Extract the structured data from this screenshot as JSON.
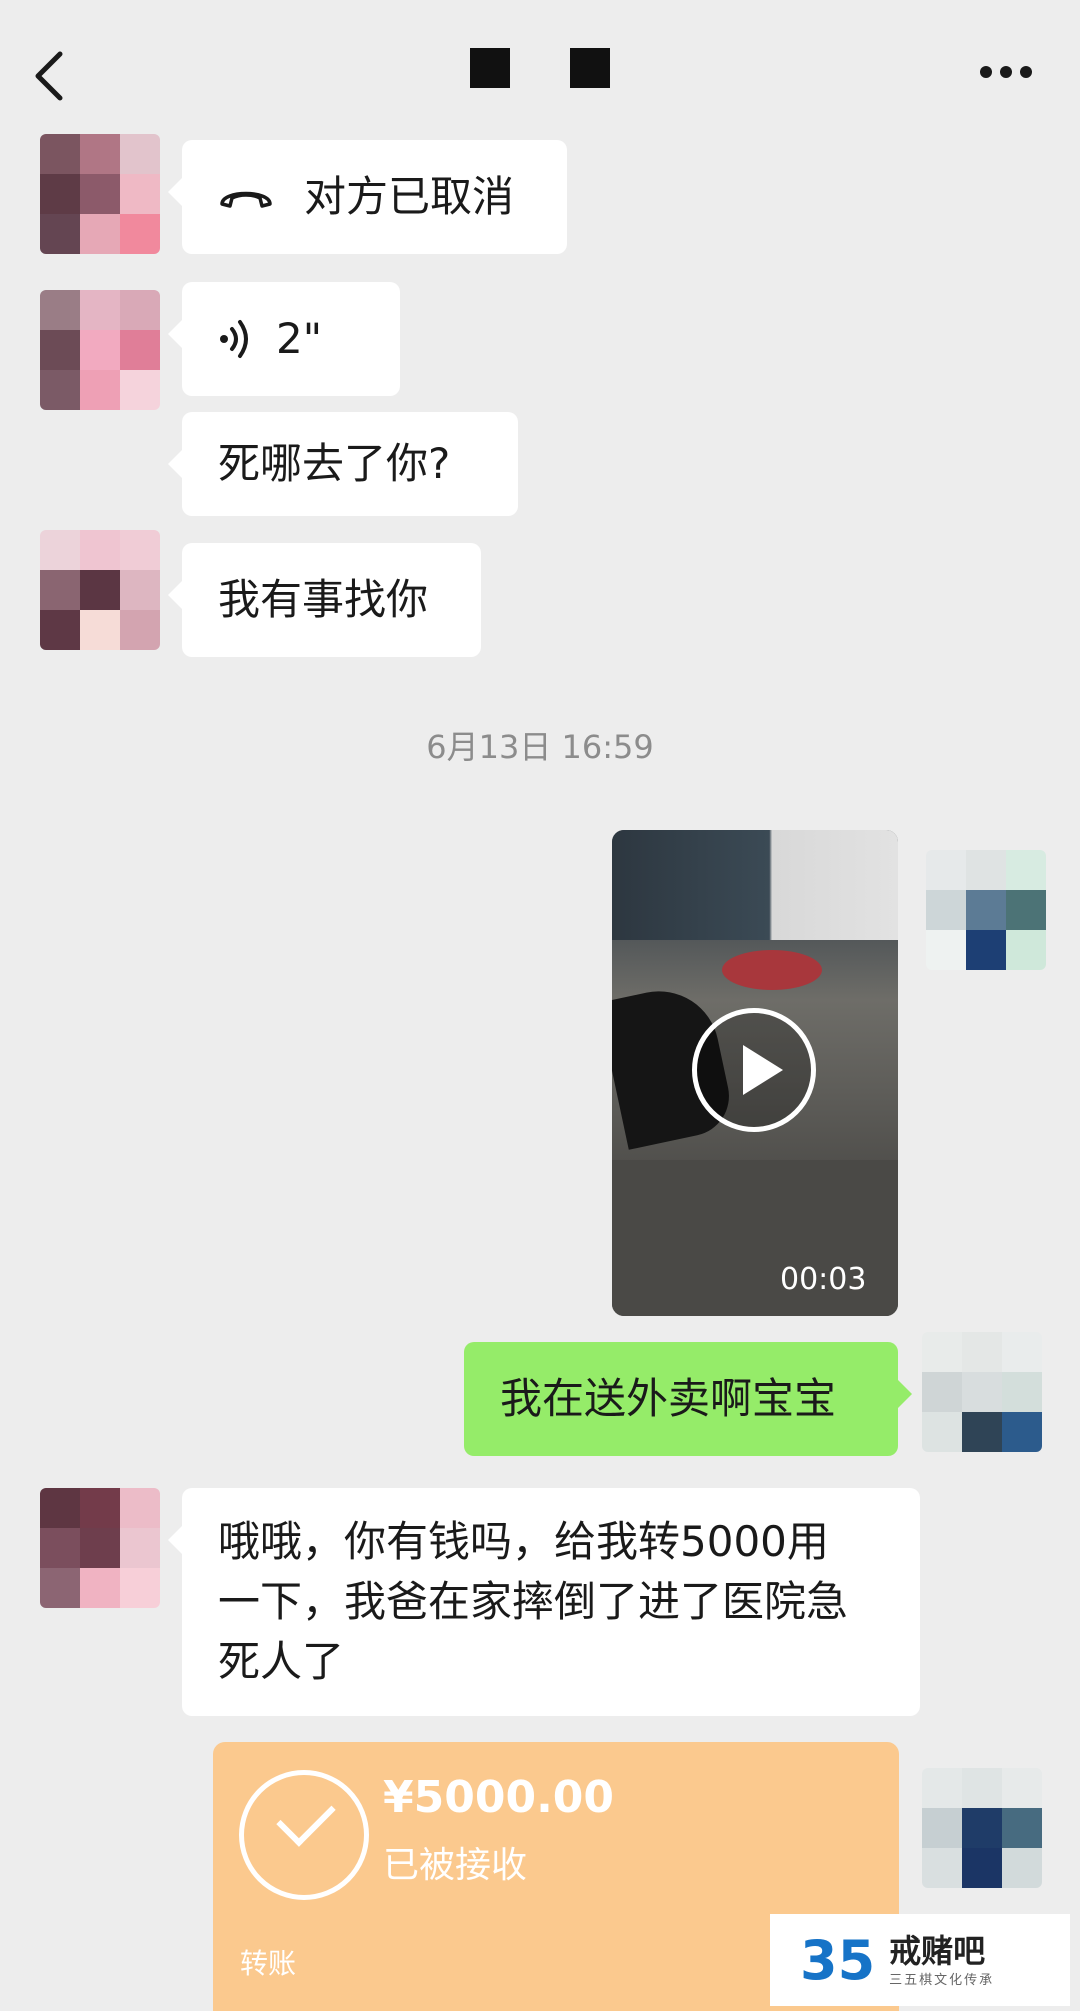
{
  "header": {
    "title": "■ ■"
  },
  "messages": {
    "call_status": "对方已取消",
    "voice_duration": "2\"",
    "text_1": "死哪去了你?",
    "text_2": "我有事找你",
    "timestamp": "6月13日 16:59",
    "video_duration": "00:03",
    "reply": "我在送外卖啊宝宝",
    "long_line1": "哦哦，你有钱吗，给我转5000用",
    "long_line2": "一下，我爸在家摔倒了进了医院急",
    "long_line3": "死人了"
  },
  "transfer": {
    "amount": "¥5000.00",
    "status": "已被接收",
    "label": "转账"
  },
  "watermark": {
    "logo_num": "35",
    "name": "戒赌吧",
    "sub": "三五棋文化传承"
  },
  "colors": {
    "background": "#ededed",
    "bubble_self": "#95ec69",
    "transfer": "#fbc98e"
  },
  "icons": [
    "back-icon",
    "more-icon",
    "phone-hangup-icon",
    "voice-icon",
    "play-icon",
    "check-icon"
  ]
}
